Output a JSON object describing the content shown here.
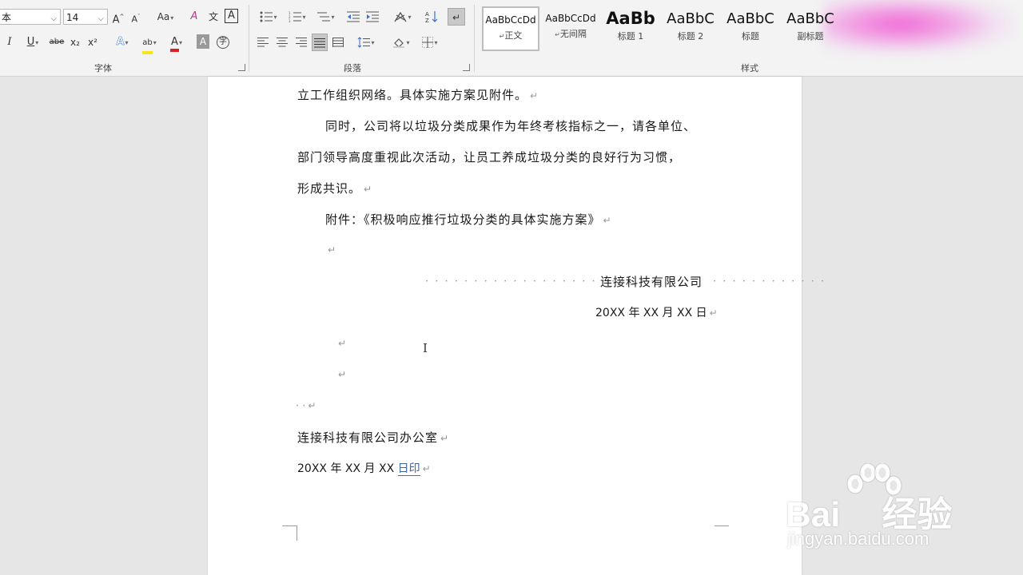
{
  "ribbon": {
    "font_group_label": "字体",
    "paragraph_group_label": "段落",
    "styles_group_label": "样式",
    "font_name_fragment": "本",
    "font_size": "14",
    "grow_font": "A",
    "shrink_font": "A",
    "change_case": "Aa",
    "clear_format": "A",
    "phonetic_guide": "文",
    "char_border": "A",
    "italic": "I",
    "underline": "U",
    "strikethrough": "abe",
    "subscript": "x₂",
    "superscript": "x²",
    "text_effects": "A",
    "highlight": "ab",
    "font_color": "A",
    "char_shading": "A",
    "enclose_char": "字"
  },
  "styles": [
    {
      "sample": "AaBbCcDd",
      "name": "正文",
      "mark": "↵"
    },
    {
      "sample": "AaBbCcDd",
      "name": "无间隔",
      "mark": "↵"
    },
    {
      "sample": "AaBb",
      "name": "标题 1"
    },
    {
      "sample": "AaBbC",
      "name": "标题 2"
    },
    {
      "sample": "AaBbC",
      "name": "标题"
    },
    {
      "sample": "AaBbC",
      "name": "副标题"
    }
  ],
  "document": {
    "line1": "立工作组织网络。具体实施方案见附件。",
    "line2": "同时，公司将以垃圾分类成果作为年终考核指标之一，请各单位、",
    "line3": "部门领导高度重视此次活动，让员工养成垃圾分类的良好行为习惯，",
    "line4": "形成共识。",
    "line5": "附件：《积极响应推行垃圾分类的具体实施方案》",
    "company_signature": "连接科技有限公司",
    "sign_date": "20XX 年 XX 月 XX 日",
    "office_name": "连接科技有限公司办公室",
    "print_date_prefix": "20XX 年 XX 月 XX ",
    "print_date_suffix": "日印",
    "paragraph_mark": "↵",
    "leader_dots_left": "· · · · · · · · · · · · · · · · · · · · · · · ·",
    "leader_dots_right": "· · · · · · · · · · · ·",
    "small_dots": "· ·"
  },
  "watermark": {
    "brand_left": "Bai",
    "brand_right": "经验",
    "url": "jingyan.baidu.com"
  },
  "colors": {
    "ribbon_bg": "#f3f3f3",
    "canvas_bg": "#e6e6e6",
    "font_color_bar": "#e02020",
    "highlight_bar": "#f5e51b",
    "text_effects": "#3b6fd4"
  }
}
